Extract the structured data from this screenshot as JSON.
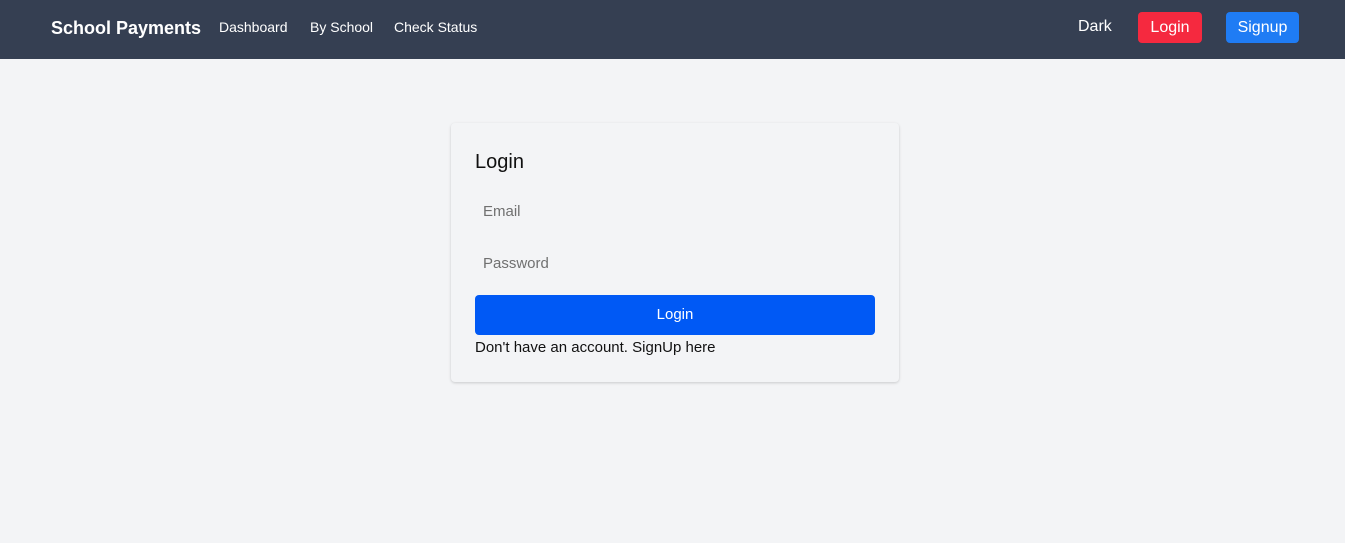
{
  "navbar": {
    "brand": "School Payments",
    "links": [
      {
        "label": "Dashboard"
      },
      {
        "label": "By School"
      },
      {
        "label": "Check Status"
      }
    ],
    "theme_toggle": "Dark",
    "login_label": "Login",
    "signup_label": "Signup"
  },
  "login_form": {
    "title": "Login",
    "email_placeholder": "Email",
    "password_placeholder": "Password",
    "submit_label": "Login",
    "signup_prompt": "Don't have an account. SignUp here"
  },
  "colors": {
    "navbar_bg": "#353f52",
    "page_bg": "#f3f4f6",
    "login_nav_button": "#f5293f",
    "signup_nav_button": "#1f7cf4",
    "primary_button": "#0059f5"
  }
}
